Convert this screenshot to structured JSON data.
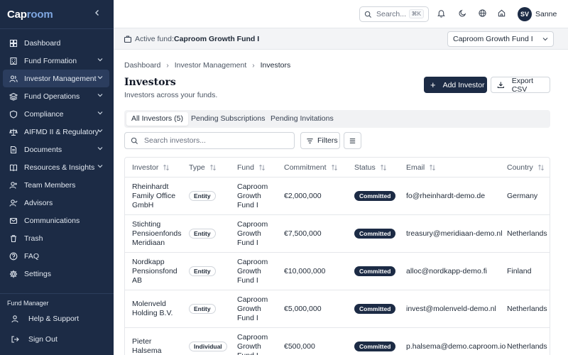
{
  "brand": {
    "name_part1": "Cap",
    "name_part2": "room"
  },
  "sidebar": {
    "items": [
      {
        "label": "Dashboard",
        "icon": "grid-icon",
        "chevron": false,
        "active": false
      },
      {
        "label": "Fund Formation",
        "icon": "building-icon",
        "chevron": true,
        "active": false
      },
      {
        "label": "Investor Management",
        "icon": "users-icon",
        "chevron": true,
        "active": true
      },
      {
        "label": "Fund Operations",
        "icon": "layers-icon",
        "chevron": true,
        "active": false
      },
      {
        "label": "Compliance",
        "icon": "shield-icon",
        "chevron": true,
        "active": false
      },
      {
        "label": "AIFMD II & Regulatory",
        "icon": "scale-icon",
        "chevron": true,
        "active": false
      },
      {
        "label": "Documents",
        "icon": "document-icon",
        "chevron": true,
        "active": false
      },
      {
        "label": "Resources & Insights",
        "icon": "book-icon",
        "chevron": true,
        "active": false
      },
      {
        "label": "Team Members",
        "icon": "user-plus-icon",
        "chevron": false,
        "active": false
      },
      {
        "label": "Advisors",
        "icon": "user-check-icon",
        "chevron": false,
        "active": false
      },
      {
        "label": "Communications",
        "icon": "mail-icon",
        "chevron": false,
        "active": false
      },
      {
        "label": "Trash",
        "icon": "trash-icon",
        "chevron": false,
        "active": false
      },
      {
        "label": "FAQ",
        "icon": "help-circle-icon",
        "chevron": false,
        "active": false
      },
      {
        "label": "Settings",
        "icon": "gear-icon",
        "chevron": false,
        "active": false
      }
    ],
    "role": "Fund Manager",
    "help": "Help & Support",
    "signout": "Sign Out"
  },
  "topbar": {
    "search_placeholder": "Search...",
    "shortcut": "⌘K",
    "avatar_initials": "SV",
    "user_name": "Sanne"
  },
  "fundbar": {
    "label": "Active fund:",
    "fund_name": "Caproom Growth Fund I",
    "selected_fund": "Caproom Growth Fund I"
  },
  "breadcrumb": [
    "Dashboard",
    "Investor Management",
    "Investors"
  ],
  "page": {
    "title": "Investors",
    "subtitle": "Investors across your funds.",
    "add_button": "Add Investor",
    "export_button": "Export CSV"
  },
  "tabs": [
    "All Investors (5)",
    "Pending Subscriptions",
    "Pending Invitations"
  ],
  "toolbar": {
    "search_placeholder": "Search investors...",
    "filters_label": "Filters"
  },
  "table": {
    "columns": [
      "Investor",
      "Type",
      "Fund",
      "Commitment",
      "Status",
      "Email",
      "Country"
    ],
    "rows": [
      {
        "investor": "Rheinhardt\nFamily Office\nGmbH",
        "type": "Entity",
        "fund": "Caproom\nGrowth\nFund I",
        "commitment": "€2,000,000",
        "status": "Committed",
        "email": "fo@rheinhardt-demo.de",
        "country": "Germany"
      },
      {
        "investor": "Stichting\nPensioenfonds\nMeridiaan",
        "type": "Entity",
        "fund": "Caproom\nGrowth\nFund I",
        "commitment": "€7,500,000",
        "status": "Committed",
        "email": "treasury@meridiaan-demo.nl",
        "country": "Netherlands"
      },
      {
        "investor": "Nordkapp\nPensionsfond\nAB",
        "type": "Entity",
        "fund": "Caproom\nGrowth\nFund I",
        "commitment": "€10,000,000",
        "status": "Committed",
        "email": "alloc@nordkapp-demo.fi",
        "country": "Finland"
      },
      {
        "investor": "Molenveld\nHolding B.V.",
        "type": "Entity",
        "fund": "Caproom\nGrowth\nFund I",
        "commitment": "€5,000,000",
        "status": "Committed",
        "email": "invest@molenveld-demo.nl",
        "country": "Netherlands"
      },
      {
        "investor": "Pieter\nHalsema",
        "type": "Individual",
        "fund": "Caproom\nGrowth\nFund I",
        "commitment": "€500,000",
        "status": "Committed",
        "email": "p.halsema@demo.caproom.io",
        "country": "Netherlands"
      }
    ]
  },
  "colors": {
    "sidebar_bg": "#1c2b45",
    "primary": "#1c2b45",
    "accent": "#7ea6e0"
  }
}
